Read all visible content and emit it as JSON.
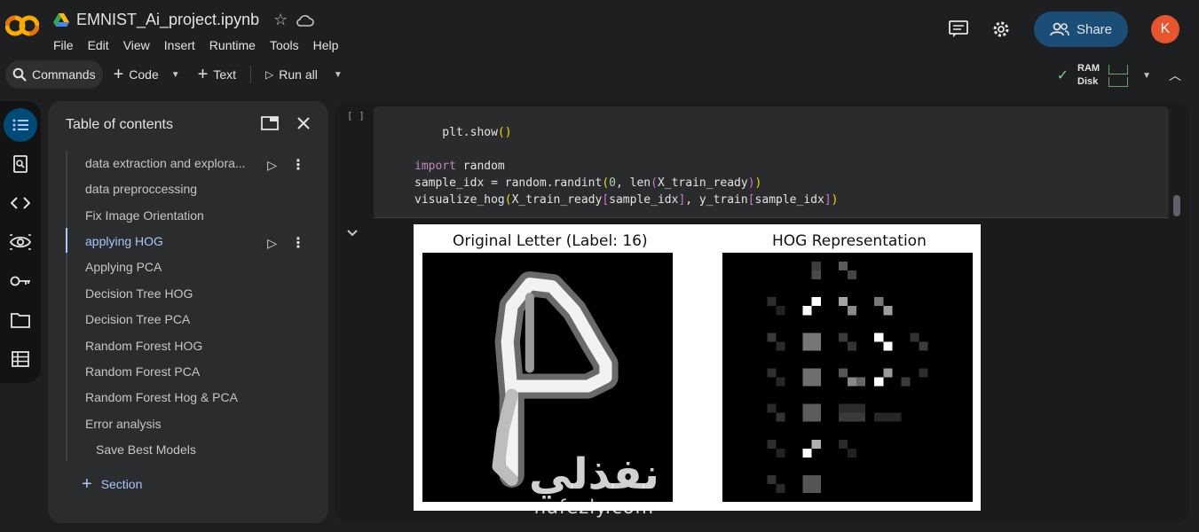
{
  "header": {
    "notebook_title": "EMNIST_Ai_project.ipynb",
    "menu": [
      "File",
      "Edit",
      "View",
      "Insert",
      "Runtime",
      "Tools",
      "Help"
    ],
    "share_label": "Share",
    "avatar_letter": "K"
  },
  "toolbar": {
    "commands_label": "Commands",
    "code_label": "Code",
    "text_label": "Text",
    "run_all_label": "Run all",
    "ram_label": "RAM",
    "disk_label": "Disk"
  },
  "toc": {
    "title": "Table of contents",
    "items": [
      {
        "label": "data extraction and explora..."
      },
      {
        "label": "data preproccessing"
      },
      {
        "label": "Fix Image Orientation"
      },
      {
        "label": "applying HOG"
      },
      {
        "label": "Applying PCA"
      },
      {
        "label": "Decision Tree HOG"
      },
      {
        "label": "Decision Tree PCA"
      },
      {
        "label": "Random Forest HOG"
      },
      {
        "label": "Random Forest PCA"
      },
      {
        "label": "Random Forest Hog & PCA"
      },
      {
        "label": "Error analysis"
      },
      {
        "label": "Save Best Models"
      }
    ],
    "add_section_label": "Section"
  },
  "cell": {
    "exec_count": "[ ]",
    "code_lines": [
      "    plt.show()",
      "",
      "import random",
      "sample_idx = random.randint(0, len(X_train_ready))",
      "visualize_hog(X_train_ready[sample_idx], y_train[sample_idx])"
    ]
  },
  "output": {
    "left_title": "Original Letter (Label: 16)",
    "right_title": "HOG Representation"
  },
  "watermark": {
    "arabic": "نفذلي",
    "domain": "nafezly.com"
  },
  "colors": {
    "share_bg": "#1b4e77",
    "avatar_bg": "#e8552c",
    "accent": "#a8c7fa",
    "rail_active": "#004a77"
  }
}
